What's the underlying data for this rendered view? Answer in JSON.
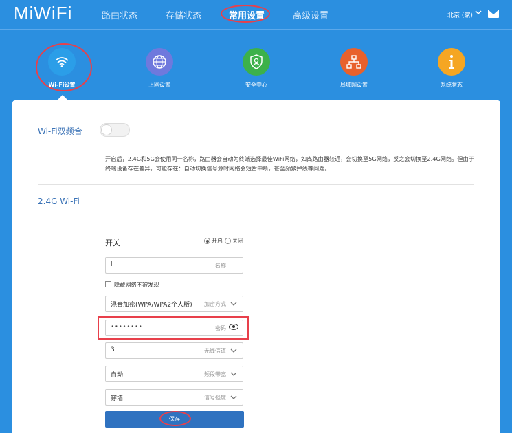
{
  "header": {
    "logo": "MiWiFi",
    "nav": [
      "路由状态",
      "存储状态",
      "常用设置",
      "高级设置"
    ],
    "region": "北京 (家)",
    "region_chevron": "chevron-down-icon",
    "mail_icon": "mail-icon"
  },
  "menu": [
    {
      "label": "Wi-Fi设置",
      "icon": "wifi-icon",
      "color": "#2b9ee8"
    },
    {
      "label": "上网设置",
      "icon": "globe-icon",
      "color": "#6f79dd"
    },
    {
      "label": "安全中心",
      "icon": "shield-icon",
      "color": "#3cb14a"
    },
    {
      "label": "局域网设置",
      "icon": "network-icon",
      "color": "#e8612c"
    },
    {
      "label": "系统状态",
      "icon": "info-icon",
      "color": "#f5a623"
    }
  ],
  "dual_band": {
    "title": "Wi-Fi双频合一",
    "enabled": false,
    "description": "开启后，2.4G和5G会使用同一名称，路由器会自动为终端选择最佳WiFi网络，如离路由器较近，会切换至5G网络，反之会切换至2.4G网络。但由于终端设备存在差异，可能存在：自动切换信号源时网络会短暂中断，甚至频繁掉线等问题。"
  },
  "wifi24": {
    "title": "2.4G Wi-Fi",
    "switch_label": "开关",
    "on_label": "开启",
    "off_label": "关闭",
    "name_value": "l",
    "name_hint": "名称",
    "hide_label": "隐藏网络不被发现",
    "encryption_value": "混合加密(WPA/WPA2个人版)",
    "encryption_hint": "加密方式",
    "password_value": "••••••••",
    "password_hint": "密码",
    "channel_value": "3",
    "channel_hint": "无线信道",
    "bandwidth_value": "自动",
    "bandwidth_hint": "频段带宽",
    "signal_value": "穿墙",
    "signal_hint": "信号强度",
    "save_label": "保存"
  },
  "colors": {
    "accent": "#2b8fe0",
    "highlight": "#e8404b",
    "save_button": "#2f72c0"
  }
}
